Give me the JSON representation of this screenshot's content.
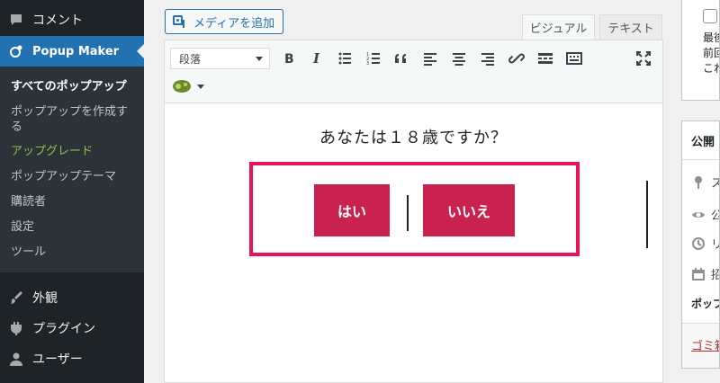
{
  "sidebar": {
    "comments_label": "コメント",
    "popup_maker_label": "Popup Maker",
    "submenu": [
      {
        "label": "すべてのポップアップ"
      },
      {
        "label": "ポップアップを作成す"
      },
      {
        "label": "る"
      },
      {
        "label": "アップグレード"
      },
      {
        "label": "ポップアップテーマ"
      },
      {
        "label": "購読者"
      },
      {
        "label": "設定"
      },
      {
        "label": "ツール"
      }
    ],
    "appearance_label": "外観",
    "plugins_label": "プラグイン",
    "users_label": "ユーザー"
  },
  "editor": {
    "add_media_label": "メディアを追加",
    "tab_visual": "ビジュアル",
    "tab_text": "テキスト",
    "format_select": "段落",
    "toolbar_icons": [
      "bold-icon",
      "italic-icon",
      "bullet-list-icon",
      "numbered-list-icon",
      "blockquote-icon",
      "align-left-icon",
      "align-center-icon",
      "align-right-icon",
      "link-icon",
      "read-more-icon",
      "toolbar-toggle-icon",
      "fullscreen-icon",
      "popup-maker-icon"
    ],
    "question": "あなたは１８歳ですか？",
    "yes_button": "はい",
    "no_button": "いいえ"
  },
  "meta_boxes": {
    "box1_lines": [
      "最後",
      "前回",
      "これ"
    ],
    "publish_title": "公開",
    "rows": [
      "ス",
      "公",
      "リ",
      "招"
    ],
    "popup_label": "ポップ",
    "trash_link": "ゴミ箱"
  },
  "colors": {
    "sidebar_bg": "#1d2327",
    "accent_blue": "#2271b1",
    "upgrade_green": "#8bc34a",
    "highlight_box": "#e9135a",
    "cta_button": "#c9224e"
  }
}
